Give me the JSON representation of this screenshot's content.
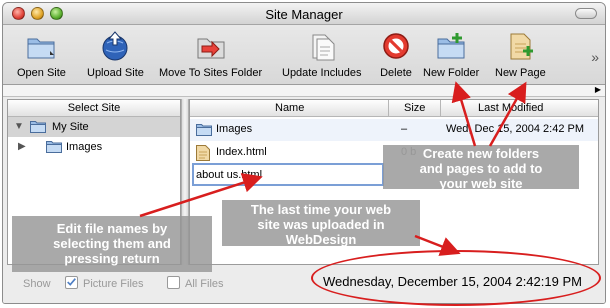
{
  "window": {
    "title": "Site Manager"
  },
  "toolbar": {
    "items": [
      {
        "label": "Open Site"
      },
      {
        "label": "Upload Site"
      },
      {
        "label": "Move To Sites Folder"
      },
      {
        "label": "Update Includes"
      },
      {
        "label": "Delete"
      },
      {
        "label": "New Folder"
      },
      {
        "label": "New Page"
      }
    ],
    "overflow_glyph": "»"
  },
  "left_pane": {
    "header": "Select Site",
    "items": [
      {
        "label": "My Site",
        "expanded": true,
        "selected": true
      },
      {
        "label": "Images",
        "expanded": false,
        "selected": false
      }
    ]
  },
  "file_table": {
    "columns": [
      "Name",
      "Size",
      "Last Modified"
    ],
    "rows": [
      {
        "name": "Images",
        "size": "–",
        "modified": "Wed, Dec 15, 2004 2:42 PM"
      },
      {
        "name": "Index.html",
        "size": "0 b",
        "modified": ""
      }
    ],
    "editing_value": "about us.html"
  },
  "status": {
    "show_label": "Show",
    "picture_files_label": "Picture Files",
    "picture_files_checked": true,
    "all_files_label": "All Files",
    "all_files_checked": false,
    "last_upload": "Wednesday, December 15, 2004 2:42:19 PM"
  },
  "callouts": {
    "new_folders": [
      "Create new folders",
      "and pages to add to",
      "your web site"
    ],
    "edit_names": [
      "Edit file names by",
      "selecting them and",
      "pressing return"
    ],
    "last_upload": [
      "The last time your web",
      "site was uploaded in",
      "WebDesign"
    ]
  },
  "colors": {
    "annotation_red": "#d81e1e",
    "selection_blue": "#7b9fd6"
  }
}
